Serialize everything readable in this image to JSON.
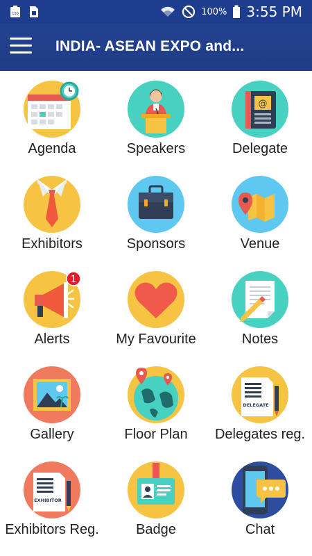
{
  "status_bar": {
    "time": "3:55 PM",
    "battery_percent": "100%",
    "left_icons": [
      "battery-100-icon",
      "sim-icon"
    ],
    "right_icons": [
      "wifi-icon",
      "do-not-disturb-icon",
      "battery-icon"
    ]
  },
  "toolbar": {
    "title": "INDIA- ASEAN EXPO and...",
    "menu_icon": "hamburger-menu-icon"
  },
  "tiles": [
    {
      "label": "Agenda",
      "icon": "calendar-clock-icon",
      "bg": "#f6c343"
    },
    {
      "label": "Speakers",
      "icon": "speaker-podium-icon",
      "bg": "#47d1c0"
    },
    {
      "label": "Delegate",
      "icon": "address-book-icon",
      "bg": "#47d1c0"
    },
    {
      "label": "Exhibitors",
      "icon": "necktie-icon",
      "bg": "#f6c343"
    },
    {
      "label": "Sponsors",
      "icon": "briefcase-icon",
      "bg": "#5ec8f0"
    },
    {
      "label": "Venue",
      "icon": "map-pin-icon",
      "bg": "#5ec8f0"
    },
    {
      "label": "Alerts",
      "icon": "megaphone-icon",
      "bg": "#f6c343",
      "badge": "1"
    },
    {
      "label": "My Favourite",
      "icon": "heart-icon",
      "bg": "#f6c343"
    },
    {
      "label": "Notes",
      "icon": "notepad-pencil-icon",
      "bg": "#47d1c0"
    },
    {
      "label": "Gallery",
      "icon": "picture-icon",
      "bg": "#f07a5e"
    },
    {
      "label": "Floor Plan",
      "icon": "globe-pins-icon",
      "bg": "#f6c343"
    },
    {
      "label": "Delegates reg.",
      "icon": "delegate-form-icon",
      "bg": "#f6c343",
      "form_text": "DELEGATE"
    },
    {
      "label": "Exhibitors Reg.",
      "icon": "exhibitor-form-icon",
      "bg": "#f07a5e",
      "form_text": "EXHIBITOR"
    },
    {
      "label": "Badge",
      "icon": "id-badge-icon",
      "bg": "#f6c343"
    },
    {
      "label": "Chat",
      "icon": "phone-chat-icon",
      "bg": "#2c4da0"
    }
  ]
}
